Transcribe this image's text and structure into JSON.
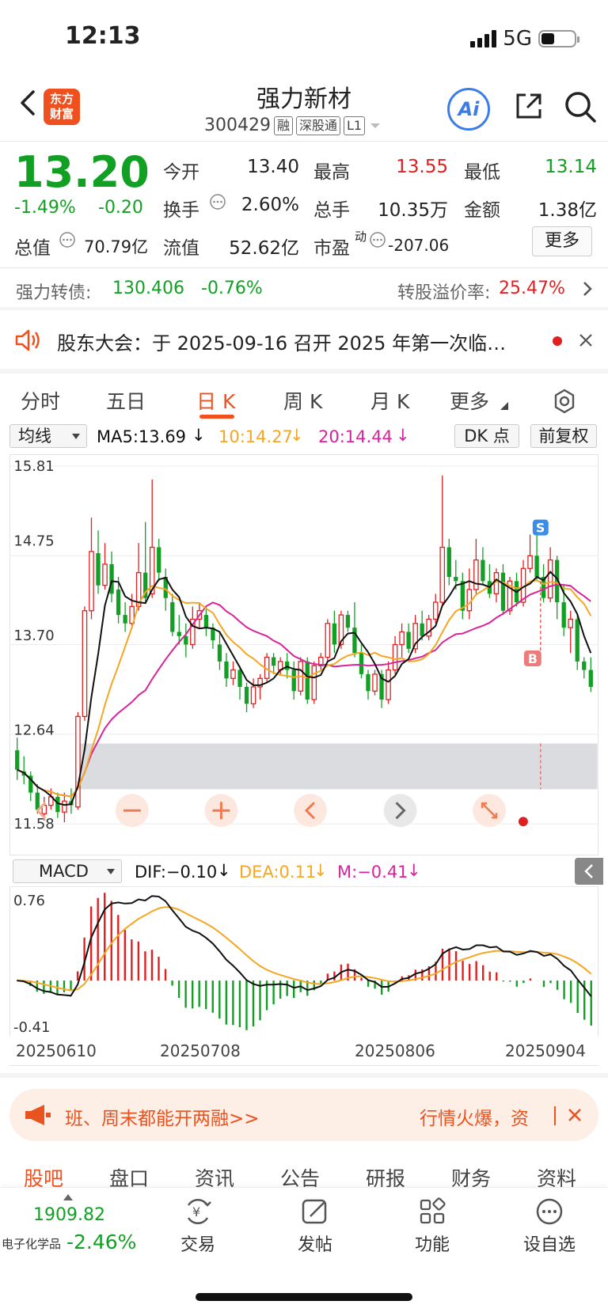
{
  "status": {
    "time": "12:13",
    "network": "5G"
  },
  "header": {
    "logo_line1": "东方",
    "logo_line2": "财富",
    "stock_name": "强力新材",
    "stock_code": "300429",
    "tags": [
      "融",
      "深股通",
      "L1"
    ],
    "ai_label": "Ai"
  },
  "quote": {
    "price": "13.20",
    "change_pct": "-1.49%",
    "change_abs": "-0.20",
    "open_label": "今开",
    "open": "13.40",
    "high_label": "最高",
    "high": "13.55",
    "low_label": "最低",
    "low": "13.14",
    "turnover_label": "换手",
    "turnover": "2.60%",
    "volume_label": "总手",
    "volume": "10.35万",
    "amount_label": "金额",
    "amount": "1.38亿",
    "mktcap_label": "总值",
    "mktcap": "70.79亿",
    "float_label": "流值",
    "float": "52.62亿",
    "pe_label": "市盈",
    "pe_sup": "动",
    "pe": "-207.06",
    "more_label": "更多"
  },
  "bond": {
    "name": "强力转债:",
    "price": "130.406",
    "change": "-0.76%",
    "premium_label": "转股溢价率:",
    "premium": "25.47%"
  },
  "notice": {
    "text": "股东大会：于 2025-09-16 召开 2025 年第一次临…"
  },
  "tabs": [
    "分时",
    "五日",
    "日 K",
    "周 K",
    "月 K",
    "更多"
  ],
  "ma_row": {
    "selector": "均线",
    "ma5": "MA5:13.69",
    "ma10": "10:14.27",
    "ma20": "20:14.44",
    "dk": "DK 点",
    "fq": "前复权"
  },
  "kchart_labels": {
    "p1": "15.81",
    "p2": "14.75",
    "p3": "13.70",
    "p4": "12.64",
    "p5": "11.58",
    "s_marker": "S",
    "b_marker": "B"
  },
  "macd_row": {
    "selector": "MACD",
    "dif": "DIF:−0.10",
    "dea": "DEA:0.11",
    "m": "M:−0.41"
  },
  "macd_labels": {
    "top": "0.76",
    "bottom": "-0.41"
  },
  "dates": [
    "20250610",
    "20250708",
    "20250806",
    "20250904"
  ],
  "banner": {
    "text_left": "班、周末都能开两融>>",
    "text_right": "行情火爆，资"
  },
  "bottom_tabs": [
    "股吧",
    "盘口",
    "资讯",
    "公告",
    "研报",
    "财务",
    "资料"
  ],
  "bottom_nav": {
    "index_value": "1909.82",
    "index_name": "电子化学品",
    "index_change": "-2.46%",
    "items": [
      "交易",
      "发帖",
      "功能",
      "设自选"
    ]
  },
  "colors": {
    "up": "#e02020",
    "down": "#12a024",
    "ma5": "#111111",
    "ma10": "#f5a623",
    "ma20": "#d6259a",
    "accent": "#f0501e"
  },
  "chart_data": {
    "type": "candlestick",
    "ylim": [
      11.58,
      15.81
    ],
    "yticks": [
      15.81,
      14.75,
      13.7,
      12.64,
      11.58
    ],
    "x_labels": [
      "20250610",
      "20250708",
      "20250806",
      "20250904"
    ],
    "candles": [
      [
        12.45,
        12.22,
        12.6,
        12.1
      ],
      [
        12.2,
        12.15,
        12.38,
        12.05
      ],
      [
        12.15,
        11.95,
        12.2,
        11.85
      ],
      [
        11.95,
        11.75,
        12.05,
        11.7
      ],
      [
        11.7,
        11.8,
        11.9,
        11.62
      ],
      [
        11.8,
        11.9,
        12.0,
        11.75
      ],
      [
        11.9,
        11.72,
        11.95,
        11.65
      ],
      [
        11.72,
        11.85,
        11.95,
        11.6
      ],
      [
        11.85,
        11.8,
        12.0,
        11.7
      ],
      [
        11.78,
        12.85,
        12.9,
        11.75
      ],
      [
        12.85,
        14.1,
        14.15,
        12.8
      ],
      [
        14.1,
        14.8,
        15.2,
        14.0
      ],
      [
        14.78,
        14.4,
        15.05,
        14.3
      ],
      [
        14.4,
        14.65,
        14.9,
        14.35
      ],
      [
        14.65,
        14.3,
        14.8,
        14.2
      ],
      [
        14.35,
        14.05,
        14.5,
        13.95
      ],
      [
        14.05,
        13.95,
        14.2,
        13.85
      ],
      [
        13.95,
        14.15,
        14.3,
        13.9
      ],
      [
        14.15,
        14.55,
        14.9,
        14.1
      ],
      [
        14.55,
        14.25,
        15.15,
        14.2
      ],
      [
        14.3,
        14.85,
        15.65,
        14.25
      ],
      [
        14.85,
        14.55,
        14.95,
        14.45
      ],
      [
        14.5,
        14.25,
        14.6,
        14.1
      ],
      [
        14.2,
        13.85,
        14.3,
        13.8
      ],
      [
        13.85,
        13.8,
        14.05,
        13.7
      ],
      [
        13.8,
        13.7,
        13.95,
        13.55
      ],
      [
        13.7,
        14.0,
        14.15,
        13.65
      ],
      [
        14.0,
        14.1,
        14.2,
        13.9
      ],
      [
        14.05,
        13.9,
        14.15,
        13.8
      ],
      [
        13.9,
        13.75,
        13.95,
        13.65
      ],
      [
        13.7,
        13.5,
        13.85,
        13.4
      ],
      [
        13.5,
        13.3,
        13.6,
        13.2
      ],
      [
        13.3,
        13.4,
        13.5,
        13.22
      ],
      [
        13.4,
        13.2,
        13.45,
        13.05
      ],
      [
        13.2,
        13.0,
        13.25,
        12.9
      ],
      [
        13.0,
        13.2,
        13.3,
        12.95
      ],
      [
        13.2,
        13.3,
        13.35,
        13.05
      ],
      [
        13.3,
        13.55,
        13.6,
        13.25
      ],
      [
        13.55,
        13.45,
        13.6,
        13.35
      ],
      [
        13.4,
        13.5,
        13.55,
        13.35
      ],
      [
        13.5,
        13.4,
        13.6,
        13.3
      ],
      [
        13.4,
        13.15,
        13.5,
        13.05
      ],
      [
        13.15,
        13.5,
        13.55,
        13.1
      ],
      [
        13.5,
        13.05,
        13.55,
        13.0
      ],
      [
        13.05,
        13.45,
        13.5,
        13.0
      ],
      [
        13.45,
        13.55,
        13.6,
        13.4
      ],
      [
        13.55,
        13.95,
        14.0,
        13.5
      ],
      [
        13.95,
        13.7,
        14.1,
        13.6
      ],
      [
        13.7,
        14.05,
        14.1,
        13.65
      ],
      [
        14.05,
        13.9,
        14.1,
        13.85
      ],
      [
        13.9,
        13.6,
        14.2,
        13.55
      ],
      [
        13.6,
        13.35,
        13.7,
        13.3
      ],
      [
        13.35,
        13.15,
        13.4,
        13.05
      ],
      [
        13.15,
        13.35,
        13.4,
        13.1
      ],
      [
        13.35,
        13.05,
        13.4,
        12.95
      ],
      [
        13.05,
        13.4,
        13.5,
        13.0
      ],
      [
        13.4,
        13.7,
        13.8,
        13.35
      ],
      [
        13.7,
        13.85,
        13.95,
        13.55
      ],
      [
        13.85,
        13.65,
        13.95,
        13.6
      ],
      [
        13.65,
        13.95,
        14.05,
        13.6
      ],
      [
        13.95,
        13.8,
        14.1,
        13.75
      ],
      [
        13.8,
        14.0,
        14.05,
        13.75
      ],
      [
        14.0,
        14.2,
        14.3,
        13.95
      ],
      [
        14.2,
        14.85,
        15.7,
        14.15
      ],
      [
        14.85,
        14.5,
        14.95,
        14.4
      ],
      [
        14.5,
        14.45,
        14.7,
        14.35
      ],
      [
        14.45,
        14.1,
        14.55,
        14.0
      ],
      [
        14.1,
        14.35,
        14.6,
        14.0
      ],
      [
        14.35,
        14.7,
        14.95,
        14.3
      ],
      [
        14.7,
        14.45,
        14.85,
        14.4
      ],
      [
        14.45,
        14.3,
        14.65,
        14.25
      ],
      [
        14.3,
        14.55,
        14.6,
        14.2
      ],
      [
        14.55,
        14.1,
        14.65,
        14.05
      ],
      [
        14.1,
        14.45,
        14.5,
        14.05
      ],
      [
        14.45,
        14.2,
        14.55,
        14.15
      ],
      [
        14.2,
        14.6,
        14.7,
        14.15
      ],
      [
        14.6,
        14.75,
        15.0,
        14.55
      ],
      [
        14.75,
        14.5,
        15.15,
        14.45
      ],
      [
        14.5,
        14.25,
        14.65,
        14.2
      ],
      [
        14.25,
        14.7,
        14.85,
        14.2
      ],
      [
        14.7,
        14.2,
        14.75,
        14.0
      ],
      [
        14.2,
        13.9,
        14.4,
        13.8
      ],
      [
        13.9,
        14.0,
        14.1,
        13.6
      ],
      [
        14.0,
        13.5,
        14.05,
        13.4
      ],
      [
        13.5,
        13.4,
        13.55,
        13.3
      ],
      [
        13.4,
        13.2,
        13.55,
        13.14
      ]
    ],
    "macd_ylim": [
      -0.41,
      0.76
    ]
  }
}
